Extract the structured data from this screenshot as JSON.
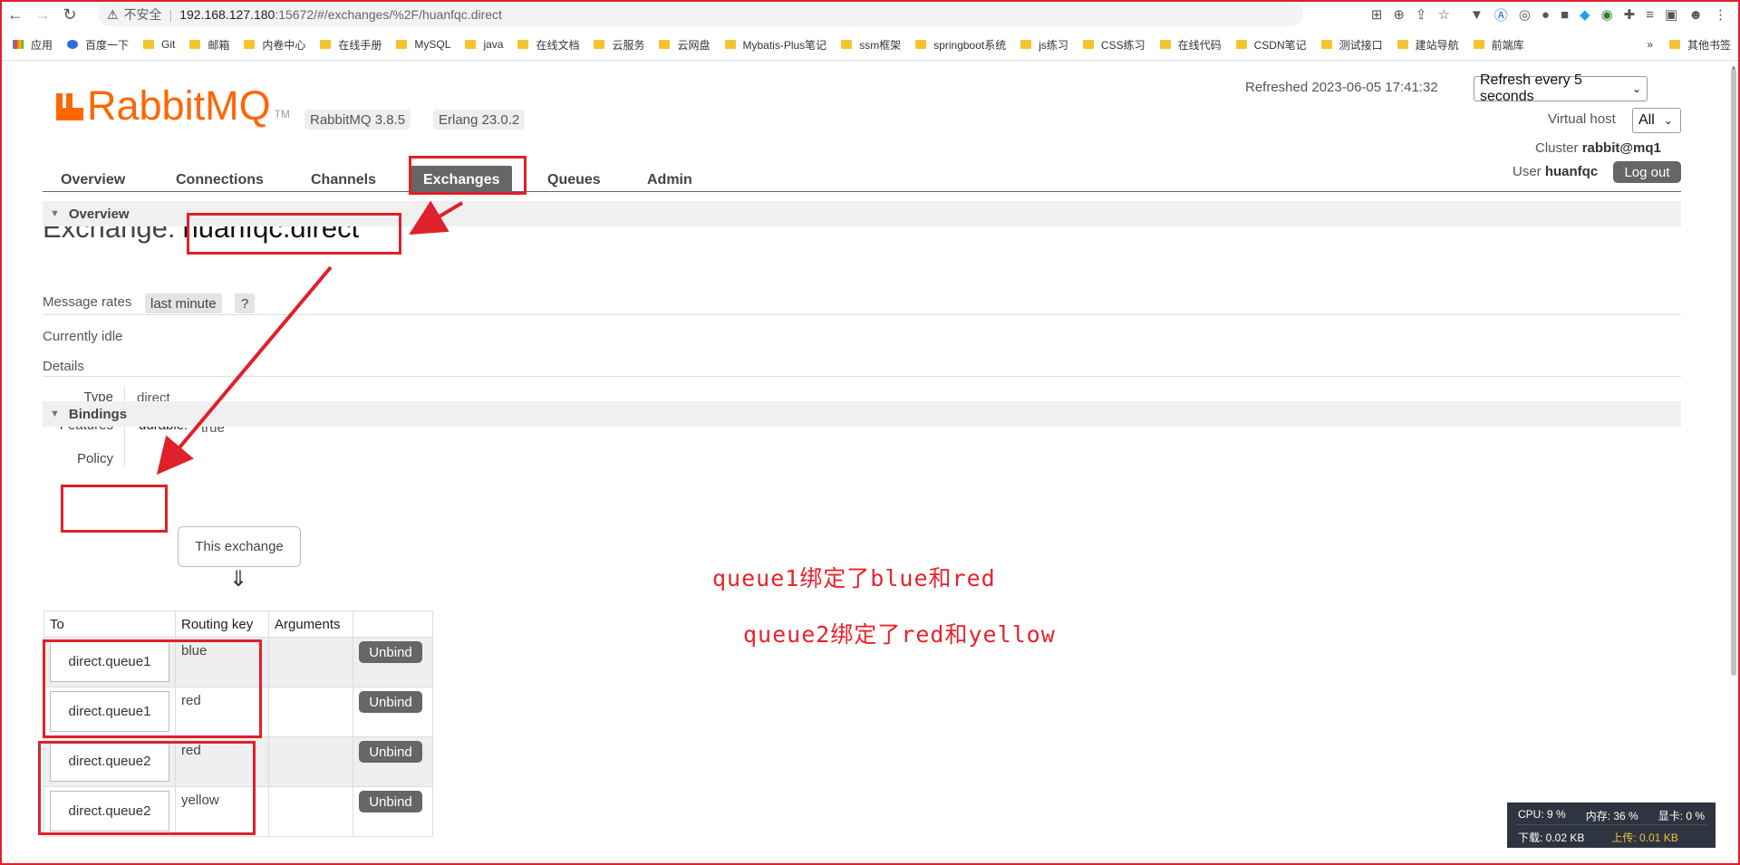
{
  "browser": {
    "security": "不安全",
    "host": "192.168.127.180",
    "url_rest": ":15672/#/exchanges/%2F/huanfqc.direct",
    "bookmarks": [
      "应用",
      "百度一下",
      "Git",
      "邮箱",
      "内卷中心",
      "在线手册",
      "MySQL",
      "java",
      "在线文档",
      "云服务",
      "云网盘",
      "Mybatis-Plus笔记",
      "ssm框架",
      "springboot系统",
      "js练习",
      "CSS练习",
      "在线代码",
      "CSDN笔记",
      "测试接口",
      "建站导航",
      "前端库"
    ],
    "other_bookmarks": "其他书签"
  },
  "header": {
    "logo_text": "RabbitMQ",
    "tm": "TM",
    "version": "RabbitMQ 3.8.5",
    "erlang": "Erlang 23.0.2",
    "refreshed_label": "Refreshed 2023-06-05 17:41:32",
    "refresh_select": "Refresh every 5 seconds",
    "vhost_label": "Virtual host",
    "vhost_select": "All",
    "cluster_label": "Cluster",
    "cluster_value": "rabbit@mq1",
    "user_label": "User",
    "user_value": "huanfqc",
    "logout": "Log out"
  },
  "tabs": [
    "Overview",
    "Connections",
    "Channels",
    "Exchanges",
    "Queues",
    "Admin"
  ],
  "exchange": {
    "title_prefix": "Exchange:",
    "name": "huanfqc.direct",
    "overview_header": "Overview",
    "message_rates": "Message rates",
    "rates_chip": "last minute",
    "help": "?",
    "idle": "Currently idle",
    "details": "Details",
    "type_label": "Type",
    "type_value": "direct",
    "features_label": "Features",
    "features_key": "durable:",
    "features_value": "true",
    "policy_label": "Policy"
  },
  "bindings": {
    "header": "Bindings",
    "this_exchange": "This exchange",
    "arrow": "⇓",
    "columns": [
      "To",
      "Routing key",
      "Arguments",
      ""
    ],
    "rows": [
      {
        "to": "direct.queue1",
        "key": "blue",
        "args": "",
        "action": "Unbind"
      },
      {
        "to": "direct.queue1",
        "key": "red",
        "args": "",
        "action": "Unbind"
      },
      {
        "to": "direct.queue2",
        "key": "red",
        "args": "",
        "action": "Unbind"
      },
      {
        "to": "direct.queue2",
        "key": "yellow",
        "args": "",
        "action": "Unbind"
      }
    ]
  },
  "annotations": {
    "line1": "queue1绑定了blue和red",
    "line2": "queue2绑定了red和yellow"
  },
  "sysmon": {
    "cpu": "CPU: 9 %",
    "mem": "内存: 36 %",
    "gpu": "显卡: 0 %",
    "down": "下载: 0.02 KB",
    "up": "上传: 0.01 KB"
  },
  "colors": {
    "brand": "#ff6600",
    "annotation": "#e8232b",
    "tab_active": "#666666"
  }
}
